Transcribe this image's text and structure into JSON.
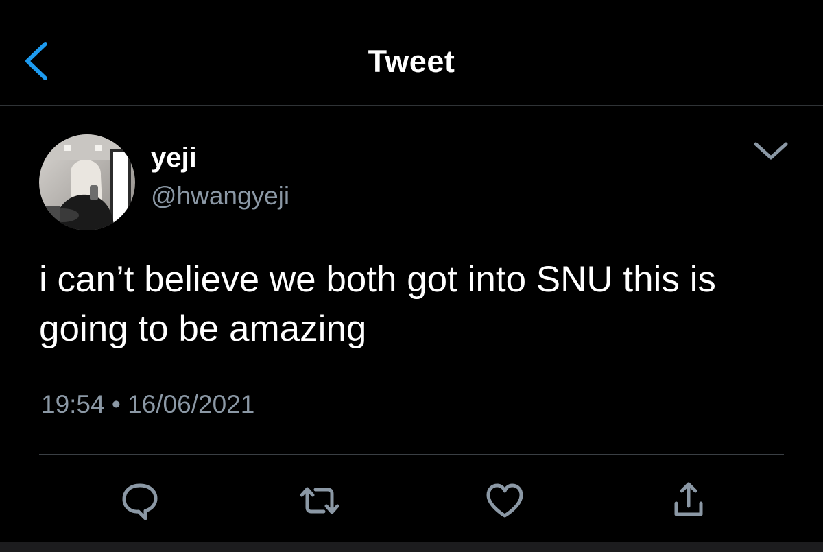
{
  "nav": {
    "title": "Tweet",
    "back_icon": "chevron-left-icon"
  },
  "author": {
    "display_name": "yeji",
    "handle": "@hwangyeji"
  },
  "tweet": {
    "text": "i can’t believe we both got into SNU this is going to be amazing",
    "time": "19:54",
    "separator": "•",
    "date": "16/06/2021"
  },
  "actions": [
    {
      "name": "reply",
      "icon": "reply-icon"
    },
    {
      "name": "retweet",
      "icon": "retweet-icon"
    },
    {
      "name": "like",
      "icon": "heart-icon"
    },
    {
      "name": "share",
      "icon": "share-icon"
    }
  ],
  "colors": {
    "background": "#000000",
    "accent": "#1d9bf0",
    "secondary_text": "#8b98a5",
    "divider": "#2f3336"
  }
}
